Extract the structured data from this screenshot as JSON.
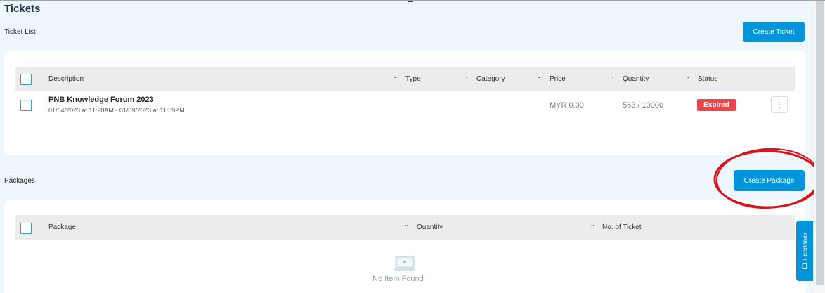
{
  "page": {
    "title": "Tickets"
  },
  "tickets": {
    "section_label": "Ticket List",
    "create_button": "Create Ticket",
    "columns": [
      "Description",
      "Type",
      "Category",
      "Price",
      "Quantity",
      "Status"
    ],
    "rows": [
      {
        "title": "PNB Knowledge Forum 2023",
        "dates": "01/04/2023 at 11:20AM - 01/09/2023 at 11:59PM",
        "type": "",
        "category": "",
        "price": "MYR 0.00",
        "quantity": "563 / 10000",
        "status": "Expired"
      }
    ]
  },
  "packages": {
    "section_label": "Packages",
    "create_button": "Create Package",
    "columns": [
      "Package",
      "Quantity",
      "No. of Ticket"
    ],
    "empty_text": "No Item Found !"
  },
  "feedback": {
    "label": "Feedback"
  },
  "icons": {
    "sort": "chevron-down-icon",
    "menu": "kebab-menu-icon",
    "empty": "empty-inbox-icon",
    "feedback": "chat-bubble-icon"
  },
  "colors": {
    "accent": "#0095db",
    "expired": "#e8474c",
    "title": "#23395b",
    "background": "#eef7fc",
    "annotation": "#d9121b"
  }
}
